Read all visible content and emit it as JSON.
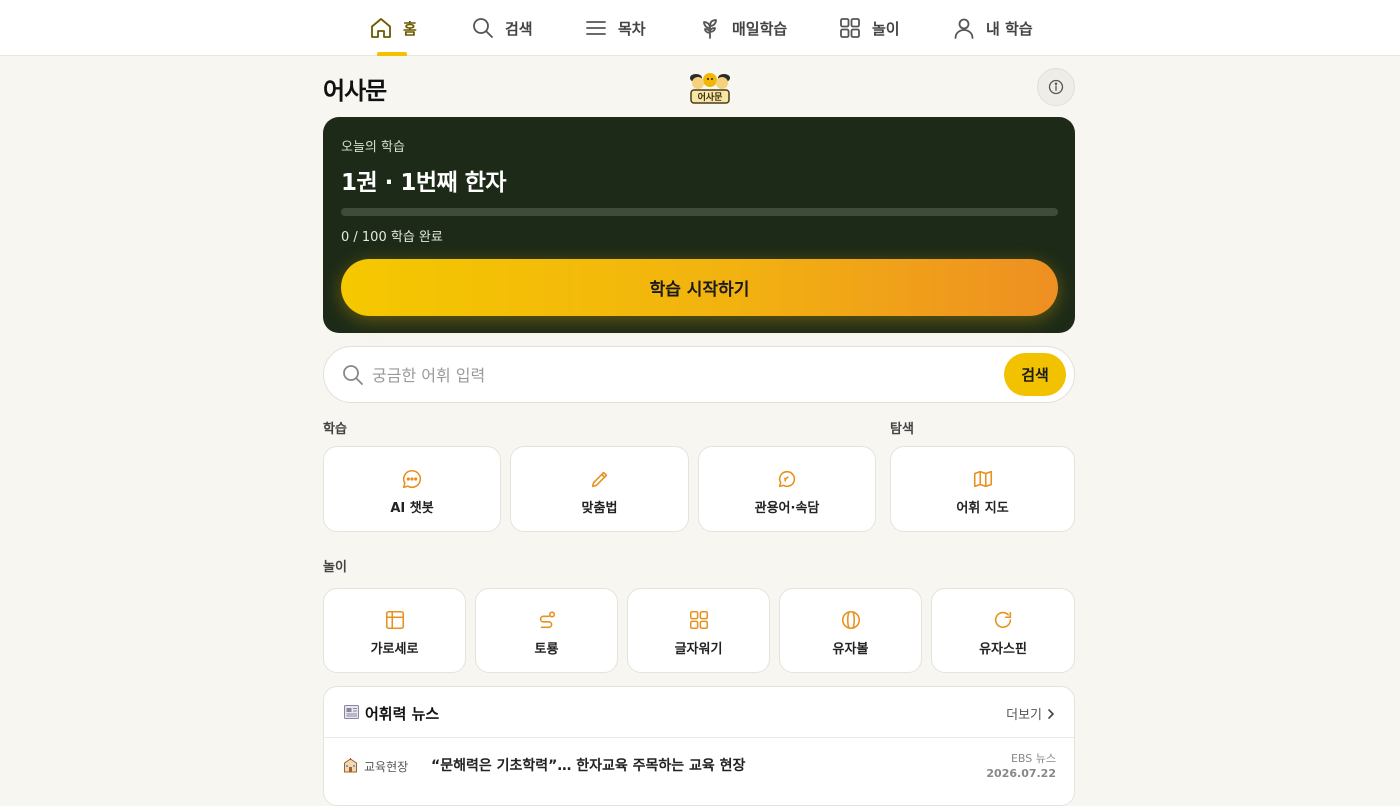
{
  "nav": {
    "items": [
      {
        "label": "홈",
        "icon": "home-icon",
        "active": true
      },
      {
        "label": "검색",
        "icon": "search-icon",
        "active": false
      },
      {
        "label": "목차",
        "icon": "menu-icon",
        "active": false
      },
      {
        "label": "매일학습",
        "icon": "sprout-icon",
        "active": false
      },
      {
        "label": "놀이",
        "icon": "grid-icon",
        "active": false
      },
      {
        "label": "내 학습",
        "icon": "user-icon",
        "active": false
      }
    ]
  },
  "header": {
    "brand": "어사문",
    "logo_text": "어사문"
  },
  "hero": {
    "eyebrow": "오늘의 학습",
    "title": "1권 · 1번째 한자",
    "progress_value": 0,
    "progress_max": 100,
    "progress_text": "0 / 100 학습 완료",
    "button_label": "학습 시작하기"
  },
  "search": {
    "placeholder": "궁금한 어휘 입력",
    "value": "",
    "button_label": "검색"
  },
  "sections": {
    "study_label": "학습",
    "explore_label": "탐색",
    "play_label": "놀이"
  },
  "study_tiles": [
    {
      "label": "AI 챗봇",
      "icon": "chat-bubble-icon"
    },
    {
      "label": "맞춤법",
      "icon": "pencil-icon"
    },
    {
      "label": "관용어·속담",
      "icon": "speech-bubble-icon"
    }
  ],
  "explore_tiles": [
    {
      "label": "어휘 지도",
      "icon": "map-icon"
    }
  ],
  "play_tiles": [
    {
      "label": "가로세로",
      "icon": "crossword-grid-icon"
    },
    {
      "label": "토룡",
      "icon": "worm-icon"
    },
    {
      "label": "글자워기",
      "icon": "four-squares-icon"
    },
    {
      "label": "유자볼",
      "icon": "ball-icon"
    },
    {
      "label": "유자스핀",
      "icon": "refresh-icon"
    }
  ],
  "news": {
    "title": "어휘력 뉴스",
    "more_label": "더보기",
    "items": [
      {
        "category": "교육현장",
        "headline": "“문해력은 기초학력”… 한자교육 주목하는 교육 현장",
        "source": "EBS 뉴스",
        "date": "2026.07.22"
      }
    ]
  },
  "colors": {
    "accent": "#f2c200",
    "accent_orange": "#ee8f22",
    "hero_bg": "#1c2a17",
    "page_bg": "#f8f6f1",
    "icon_orange": "#e8901c"
  }
}
